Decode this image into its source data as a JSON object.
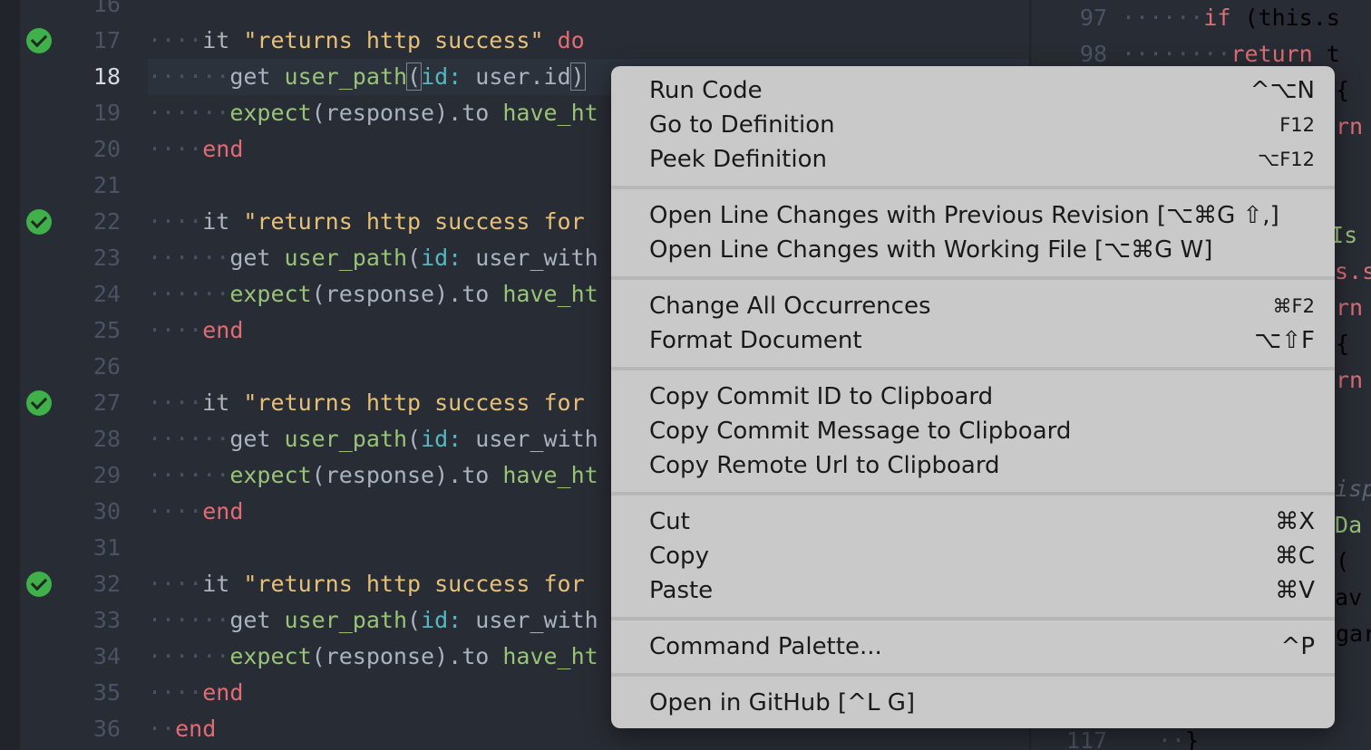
{
  "gutter": {
    "line_numbers": [
      "16",
      "17",
      "18",
      "19",
      "20",
      "21",
      "22",
      "23",
      "24",
      "25",
      "26",
      "27",
      "28",
      "29",
      "30",
      "31",
      "32",
      "33",
      "34",
      "35",
      "36"
    ],
    "active_line": "18"
  },
  "code": {
    "lines": [
      {
        "dots": "",
        "segments": []
      },
      {
        "dots": "····",
        "segments": [
          {
            "t": "it ",
            "c": ""
          },
          {
            "t": "\"returns http success\"",
            "c": "str"
          },
          {
            "t": " do",
            "c": "kw"
          }
        ]
      },
      {
        "dots": "······",
        "segments": [
          {
            "t": "get ",
            "c": ""
          },
          {
            "t": "user_path",
            "c": "fn"
          },
          {
            "t": "(",
            "c": "bracket"
          },
          {
            "t": "id:",
            "c": "sym"
          },
          {
            "t": " user.id",
            "c": ""
          },
          {
            "t": ")",
            "c": "bracket"
          }
        ]
      },
      {
        "dots": "······",
        "segments": [
          {
            "t": "expect",
            "c": "fn"
          },
          {
            "t": "(response).to ",
            "c": ""
          },
          {
            "t": "have_ht",
            "c": "fn"
          }
        ]
      },
      {
        "dots": "····",
        "segments": [
          {
            "t": "end",
            "c": "kw"
          }
        ]
      },
      {
        "dots": "",
        "segments": []
      },
      {
        "dots": "····",
        "segments": [
          {
            "t": "it ",
            "c": ""
          },
          {
            "t": "\"returns http success for",
            "c": "str"
          }
        ]
      },
      {
        "dots": "······",
        "segments": [
          {
            "t": "get ",
            "c": ""
          },
          {
            "t": "user_path",
            "c": "fn"
          },
          {
            "t": "(",
            "c": ""
          },
          {
            "t": "id:",
            "c": "sym"
          },
          {
            "t": " user_with",
            "c": ""
          }
        ]
      },
      {
        "dots": "······",
        "segments": [
          {
            "t": "expect",
            "c": "fn"
          },
          {
            "t": "(response).to ",
            "c": ""
          },
          {
            "t": "have_ht",
            "c": "fn"
          }
        ]
      },
      {
        "dots": "····",
        "segments": [
          {
            "t": "end",
            "c": "kw"
          }
        ]
      },
      {
        "dots": "",
        "segments": []
      },
      {
        "dots": "····",
        "segments": [
          {
            "t": "it ",
            "c": ""
          },
          {
            "t": "\"returns http success for",
            "c": "str"
          }
        ]
      },
      {
        "dots": "······",
        "segments": [
          {
            "t": "get ",
            "c": ""
          },
          {
            "t": "user_path",
            "c": "fn"
          },
          {
            "t": "(",
            "c": ""
          },
          {
            "t": "id:",
            "c": "sym"
          },
          {
            "t": " user_with",
            "c": ""
          }
        ]
      },
      {
        "dots": "······",
        "segments": [
          {
            "t": "expect",
            "c": "fn"
          },
          {
            "t": "(response).to ",
            "c": ""
          },
          {
            "t": "have_ht",
            "c": "fn"
          }
        ]
      },
      {
        "dots": "····",
        "segments": [
          {
            "t": "end",
            "c": "kw"
          }
        ]
      },
      {
        "dots": "",
        "segments": []
      },
      {
        "dots": "····",
        "segments": [
          {
            "t": "it ",
            "c": ""
          },
          {
            "t": "\"returns http success for",
            "c": "str"
          }
        ]
      },
      {
        "dots": "······",
        "segments": [
          {
            "t": "get ",
            "c": ""
          },
          {
            "t": "user_path",
            "c": "fn"
          },
          {
            "t": "(",
            "c": ""
          },
          {
            "t": "id:",
            "c": "sym"
          },
          {
            "t": " user_with",
            "c": ""
          }
        ]
      },
      {
        "dots": "······",
        "segments": [
          {
            "t": "expect",
            "c": "fn"
          },
          {
            "t": "(response).to ",
            "c": ""
          },
          {
            "t": "have_ht",
            "c": "fn"
          }
        ]
      },
      {
        "dots": "····",
        "segments": [
          {
            "t": "end",
            "c": "kw"
          }
        ]
      },
      {
        "dots": "··",
        "segments": [
          {
            "t": "end",
            "c": "kw"
          }
        ]
      }
    ]
  },
  "right_pane": {
    "line_numbers": [
      "97",
      "98",
      "117"
    ],
    "fragments": [
      {
        "dots": "······",
        "segments": [
          {
            "t": "if ",
            "c": "kw"
          },
          {
            "t": "(this.s",
            "c": ""
          }
        ]
      },
      {
        "dots": "········",
        "segments": [
          {
            "t": "return ",
            "c": "kw"
          },
          {
            "t": "t",
            "c": ""
          }
        ]
      },
      {
        "dots": "",
        "segments": [
          {
            "t": "{",
            "c": ""
          }
        ]
      },
      {
        "dots": "",
        "segments": [
          {
            "t": "rn ",
            "c": "kw"
          },
          {
            "t": "t",
            "c": ""
          }
        ]
      },
      {
        "dots": "",
        "segments": [
          {
            "t": "tIs",
            "c": "fn"
          }
        ]
      },
      {
        "dots": "",
        "segments": [
          {
            "t": "is.s",
            "c": "kw"
          }
        ]
      },
      {
        "dots": "",
        "segments": [
          {
            "t": "rn ",
            "c": "kw"
          },
          {
            "t": "t",
            "c": ""
          }
        ]
      },
      {
        "dots": "",
        "segments": [
          {
            "t": "{",
            "c": ""
          }
        ]
      },
      {
        "dots": "",
        "segments": [
          {
            "t": "rn ",
            "c": "kw"
          },
          {
            "t": "t",
            "c": ""
          }
        ]
      },
      {
        "dots": "",
        "segments": [
          {
            "t": "disp",
            "c": "italic"
          }
        ]
      },
      {
        "dots": "",
        "segments": [
          {
            "t": "sDa",
            "c": "fn"
          }
        ]
      },
      {
        "dots": "",
        "segments": [
          {
            "t": "(",
            "c": ""
          }
        ]
      },
      {
        "dots": "",
        "segments": [
          {
            "t": ".av",
            "c": ""
          }
        ]
      },
      {
        "dots": "",
        "segments": [
          {
            "t": "gar",
            "c": ""
          }
        ]
      },
      {
        "dots": "··",
        "segments": [
          {
            "t": "}",
            "c": ""
          }
        ]
      }
    ]
  },
  "context_menu": {
    "groups": [
      [
        {
          "label": "Run Code",
          "shortcut": "^⌥N",
          "small": false
        },
        {
          "label": "Go to Definition",
          "shortcut": "F12",
          "small": true
        },
        {
          "label": "Peek Definition",
          "shortcut": "⌥F12",
          "small": true
        }
      ],
      [
        {
          "label": "Open Line Changes with Previous Revision [⌥⌘G ⇧,]",
          "shortcut": "",
          "small": false
        },
        {
          "label": "Open Line Changes with Working File [⌥⌘G W]",
          "shortcut": "",
          "small": false
        }
      ],
      [
        {
          "label": "Change All Occurrences",
          "shortcut": "⌘F2",
          "small": true
        },
        {
          "label": "Format Document",
          "shortcut": "⌥⇧F",
          "small": false
        }
      ],
      [
        {
          "label": "Copy Commit ID to Clipboard",
          "shortcut": "",
          "small": false
        },
        {
          "label": "Copy Commit Message to Clipboard",
          "shortcut": "",
          "small": false
        },
        {
          "label": "Copy Remote Url to Clipboard",
          "shortcut": "",
          "small": false
        }
      ],
      [
        {
          "label": "Cut",
          "shortcut": "⌘X",
          "small": false
        },
        {
          "label": "Copy",
          "shortcut": "⌘C",
          "small": false
        },
        {
          "label": "Paste",
          "shortcut": "⌘V",
          "small": false
        }
      ],
      [
        {
          "label": "Command Palette...",
          "shortcut": "^P",
          "small": false
        }
      ],
      [
        {
          "label": "Open in GitHub [^L G]",
          "shortcut": "",
          "small": false
        }
      ]
    ]
  },
  "colors": {
    "check": "#3fb04a",
    "keyword": "#e06c75",
    "string": "#e5c07b",
    "function": "#98c379",
    "symbol": "#56b6c2",
    "menu_bg": "#c9c9c9"
  },
  "icons": {
    "test_pass": "check-circle-icon"
  }
}
